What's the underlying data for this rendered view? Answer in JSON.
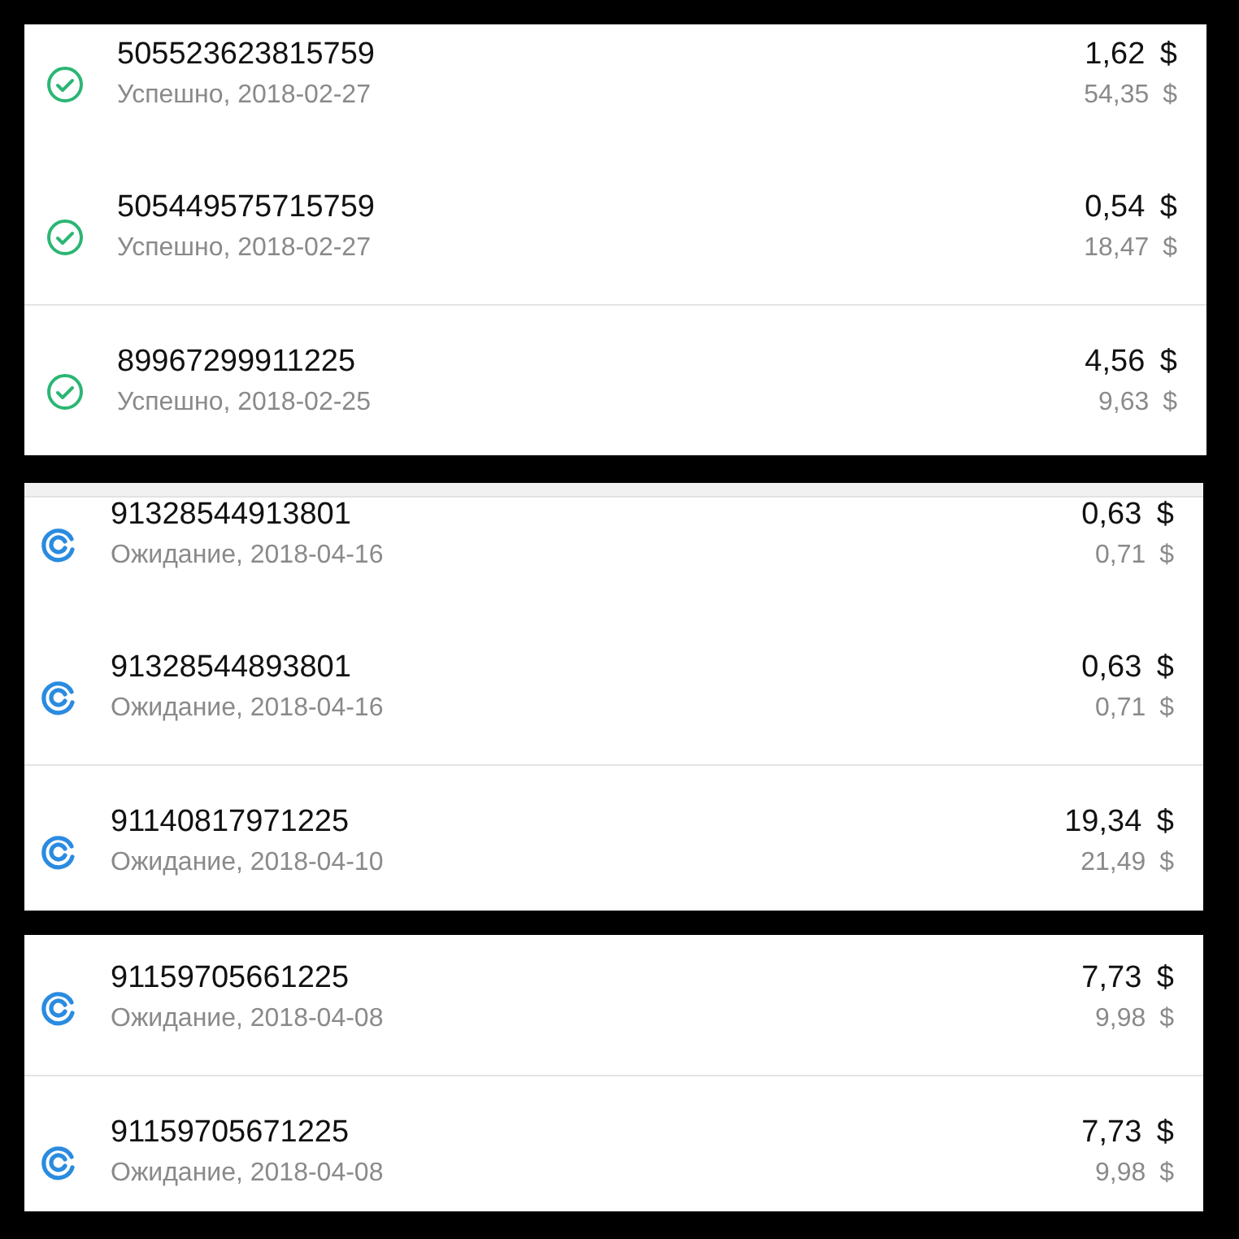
{
  "panels": [
    {
      "top_strip": false,
      "rows": [
        {
          "kind": "success",
          "number": "505523623815759",
          "status_text": "Успешно, 2018-02-27",
          "amount": "1,62 $",
          "sub_amount": "54,35 $",
          "separated": false
        },
        {
          "kind": "success",
          "number": "505449575715759",
          "status_text": "Успешно, 2018-02-27",
          "amount": "0,54 $",
          "sub_amount": "18,47 $",
          "separated": false
        },
        {
          "kind": "success",
          "number": "89967299911225",
          "status_text": "Успешно, 2018-02-25",
          "amount": "4,56 $",
          "sub_amount": "9,63 $",
          "separated": true
        }
      ]
    },
    {
      "top_strip": true,
      "rows": [
        {
          "kind": "pending",
          "number": "91328544913801",
          "status_text": "Ожидание, 2018-04-16",
          "amount": "0,63 $",
          "sub_amount": "0,71 $",
          "separated": false
        },
        {
          "kind": "pending",
          "number": "91328544893801",
          "status_text": "Ожидание, 2018-04-16",
          "amount": "0,63 $",
          "sub_amount": "0,71 $",
          "separated": false
        },
        {
          "kind": "pending",
          "number": "91140817971225",
          "status_text": "Ожидание, 2018-04-10",
          "amount": "19,34 $",
          "sub_amount": "21,49 $",
          "separated": true
        }
      ]
    },
    {
      "top_strip": false,
      "rows": [
        {
          "kind": "pending",
          "number": "91159705661225",
          "status_text": "Ожидание, 2018-04-08",
          "amount": "7,73 $",
          "sub_amount": "9,98 $",
          "separated": false
        },
        {
          "kind": "pending",
          "number": "91159705671225",
          "status_text": "Ожидание, 2018-04-08",
          "amount": "7,73 $",
          "sub_amount": "9,98 $",
          "separated": true
        }
      ]
    }
  ]
}
